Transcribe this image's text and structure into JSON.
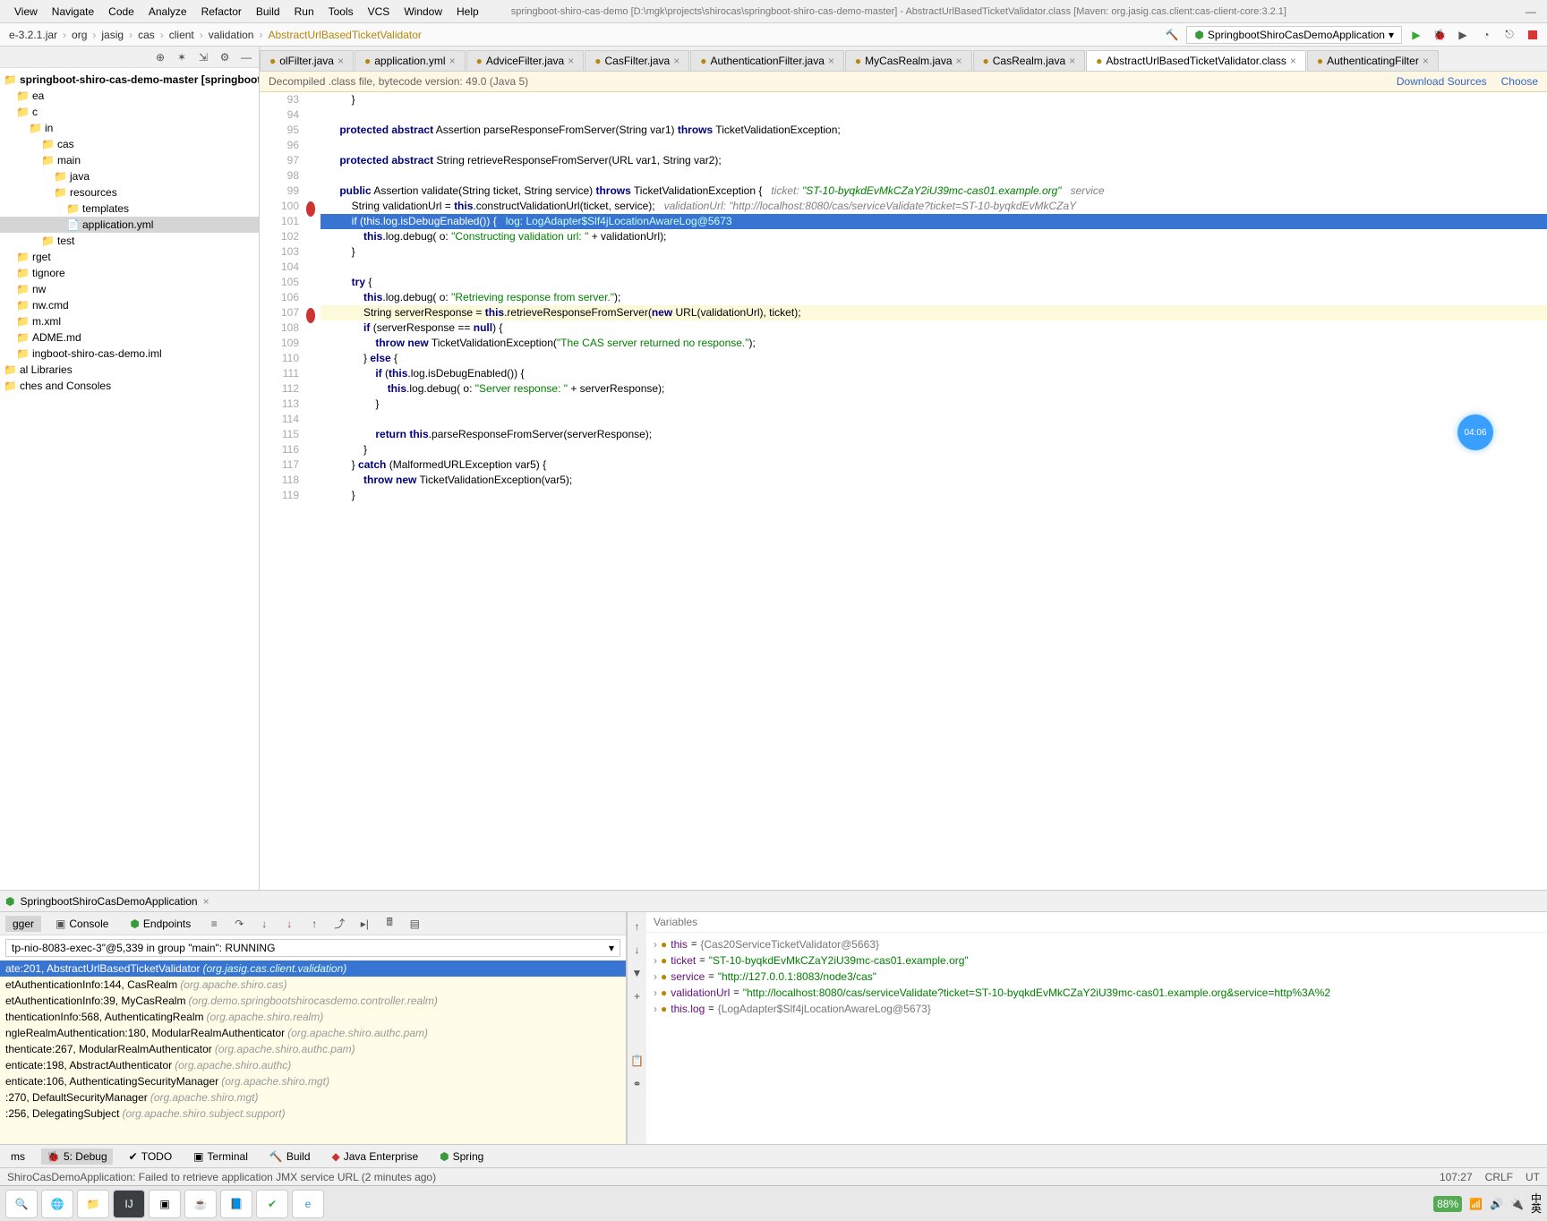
{
  "menu": [
    "View",
    "Navigate",
    "Code",
    "Analyze",
    "Refactor",
    "Build",
    "Run",
    "Tools",
    "VCS",
    "Window",
    "Help"
  ],
  "window_title": "springboot-shiro-cas-demo [D:\\mgk\\projects\\shirocas\\springboot-shiro-cas-demo-master] - AbstractUrlBasedTicketValidator.class [Maven: org.jasig.cas.client:cas-client-core:3.2.1]",
  "breadcrumb": [
    "e-3.2.1.jar",
    "org",
    "jasig",
    "cas",
    "client",
    "validation",
    "AbstractUrlBasedTicketValidator"
  ],
  "run_config": "SpringbootShiroCasDemoApplication",
  "project_tree": [
    {
      "l": 0,
      "t": "springboot-shiro-cas-demo-master [springboot-shiro-cas-demo]",
      "b": true
    },
    {
      "l": 1,
      "t": "ea"
    },
    {
      "l": 1,
      "t": "c"
    },
    {
      "l": 2,
      "t": "in"
    },
    {
      "l": 3,
      "t": "cas"
    },
    {
      "l": 3,
      "t": "main"
    },
    {
      "l": 4,
      "t": "java"
    },
    {
      "l": 4,
      "t": "resources"
    },
    {
      "l": 5,
      "t": "templates"
    },
    {
      "l": 5,
      "t": "application.yml",
      "sel": true,
      "f": true
    },
    {
      "l": 3,
      "t": "test"
    },
    {
      "l": 1,
      "t": "rget"
    },
    {
      "l": 1,
      "t": "tignore"
    },
    {
      "l": 1,
      "t": "nw"
    },
    {
      "l": 1,
      "t": "nw.cmd"
    },
    {
      "l": 1,
      "t": "m.xml"
    },
    {
      "l": 1,
      "t": "ADME.md"
    },
    {
      "l": 1,
      "t": "ingboot-shiro-cas-demo.iml"
    },
    {
      "l": 0,
      "t": "al Libraries"
    },
    {
      "l": 0,
      "t": "ches and Consoles"
    }
  ],
  "editor_tabs": [
    {
      "label": "olFilter.java"
    },
    {
      "label": "application.yml"
    },
    {
      "label": "AdviceFilter.java"
    },
    {
      "label": "CasFilter.java"
    },
    {
      "label": "AuthenticationFilter.java"
    },
    {
      "label": "MyCasRealm.java"
    },
    {
      "label": "CasRealm.java"
    },
    {
      "label": "AbstractUrlBasedTicketValidator.class",
      "act": true
    },
    {
      "label": "AuthenticatingFilter"
    }
  ],
  "banner_text": "Decompiled .class file, bytecode version: 49.0 (Java 5)",
  "banner_links": [
    "Download Sources",
    "Choose"
  ],
  "line_start": 93,
  "code_lines": [
    "        }",
    "",
    "    protected abstract Assertion parseResponseFromServer(String var1) throws TicketValidationException;",
    "",
    "    protected abstract String retrieveResponseFromServer(URL var1, String var2);",
    "",
    "    public Assertion validate(String ticket, String service) throws TicketValidationException {   ticket: \"ST-10-byqkdEvMkCZaY2iU39mc-cas01.example.org\"   service",
    "        String validationUrl = this.constructValidationUrl(ticket, service);   validationUrl: \"http://localhost:8080/cas/serviceValidate?ticket=ST-10-byqkdEvMkCZaY",
    "        if (this.log.isDebugEnabled()) {   log: LogAdapter$Slf4jLocationAwareLog@5673",
    "            this.log.debug( o: \"Constructing validation url: \" + validationUrl);",
    "        }",
    "",
    "        try {",
    "            this.log.debug( o: \"Retrieving response from server.\");",
    "            String serverResponse = this.retrieveResponseFromServer(new URL(validationUrl), ticket);",
    "            if (serverResponse == null) {",
    "                throw new TicketValidationException(\"The CAS server returned no response.\");",
    "            } else {",
    "                if (this.log.isDebugEnabled()) {",
    "                    this.log.debug( o: \"Server response: \" + serverResponse);",
    "                }",
    "",
    "                return this.parseResponseFromServer(serverResponse);",
    "            }",
    "        } catch (MalformedURLException var5) {",
    "            throw new TicketValidationException(var5);",
    "        }"
  ],
  "code_hl_line": 8,
  "code_cur_line": 14,
  "bp_lines": [
    7,
    14
  ],
  "timer": "04:06",
  "dbg_run_name": "SpringbootShiroCasDemoApplication",
  "dbg_subtabs": [
    "gger",
    "Console",
    "Endpoints"
  ],
  "thread_text": "tp-nio-8083-exec-3\"@5,339 in group \"main\": RUNNING",
  "frames": [
    {
      "m": "ate:201, AbstractUrlBasedTicketValidator",
      "p": "(org.jasig.cas.client.validation)",
      "sel": true
    },
    {
      "m": "etAuthenticationInfo:144, CasRealm",
      "p": "(org.apache.shiro.cas)"
    },
    {
      "m": "etAuthenticationInfo:39, MyCasRealm",
      "p": "(org.demo.springbootshirocasdemo.controller.realm)"
    },
    {
      "m": "thenticationInfo:568, AuthenticatingRealm",
      "p": "(org.apache.shiro.realm)"
    },
    {
      "m": "ngleRealmAuthentication:180, ModularRealmAuthenticator",
      "p": "(org.apache.shiro.authc.pam)"
    },
    {
      "m": "thenticate:267, ModularRealmAuthenticator",
      "p": "(org.apache.shiro.authc.pam)"
    },
    {
      "m": "enticate:198, AbstractAuthenticator",
      "p": "(org.apache.shiro.authc)"
    },
    {
      "m": "enticate:106, AuthenticatingSecurityManager",
      "p": "(org.apache.shiro.mgt)"
    },
    {
      "m": ":270, DefaultSecurityManager",
      "p": "(org.apache.shiro.mgt)"
    },
    {
      "m": ":256, DelegatingSubject",
      "p": "(org.apache.shiro.subject.support)"
    }
  ],
  "vars_header": "Variables",
  "vars": [
    {
      "n": "this",
      "v": "{Cas20ServiceTicketValidator@5663}",
      "obj": true
    },
    {
      "n": "ticket",
      "v": "\"ST-10-byqkdEvMkCZaY2iU39mc-cas01.example.org\""
    },
    {
      "n": "service",
      "v": "\"http://127.0.0.1:8083/node3/cas\""
    },
    {
      "n": "validationUrl",
      "v": "\"http://localhost:8080/cas/serviceValidate?ticket=ST-10-byqkdEvMkCZaY2iU39mc-cas01.example.org&service=http%3A%2"
    },
    {
      "n": "this.log",
      "v": "{LogAdapter$Slf4jLocationAwareLog@5673}",
      "obj": true
    }
  ],
  "bottom_tabs": [
    "ms",
    "5: Debug",
    "TODO",
    "Terminal",
    "Build",
    "Java Enterprise",
    "Spring"
  ],
  "status_msg": "ShiroCasDemoApplication: Failed to retrieve application JMX service URL (2 minutes ago)",
  "status_right": {
    "pos": "107:27",
    "crlf": "CRLF",
    "enc": "UT",
    "zoom": "88%",
    "ime": "中\n英"
  },
  "tray": {
    "net": "⬆⬇"
  }
}
